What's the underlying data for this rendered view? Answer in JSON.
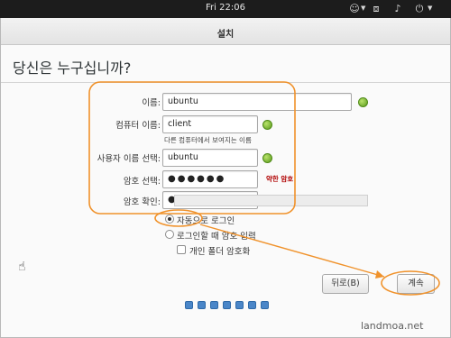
{
  "topbar": {
    "time": "Fri 22:06",
    "icons": [
      "accessibility-icon",
      "network-icon",
      "volume-icon",
      "power-icon"
    ]
  },
  "window": {
    "title": "설치",
    "heading": "당신은 누구십니까?"
  },
  "form": {
    "name_label": "이름:",
    "name_value": "ubuntu",
    "computer_label": "컴퓨터 이름:",
    "computer_value": "client",
    "computer_hint": "다른 컴퓨터에서 보여지는 이름",
    "username_label": "사용자 이름 선택:",
    "username_value": "ubuntu",
    "password_label": "암호 선택:",
    "password_value": "●●●●●●",
    "password_strength": "약한 암호",
    "confirm_label": "암호 확인:",
    "confirm_value": "●●●●●●"
  },
  "options": {
    "auto_login": "자동으로 로그인",
    "require_password": "로그인할 때 암호 입력",
    "encrypt_home": "개인 폴더 암호화",
    "selected": "auto_login"
  },
  "buttons": {
    "back": "뒤로(B)",
    "continue": "계속"
  },
  "progress": {
    "total_steps": 7
  },
  "colors": {
    "annotation": "#f0922b",
    "ok": "#6aab22",
    "weak": "#b00000",
    "step_dot": "#4a86c8"
  },
  "watermark": "landmoa.net"
}
